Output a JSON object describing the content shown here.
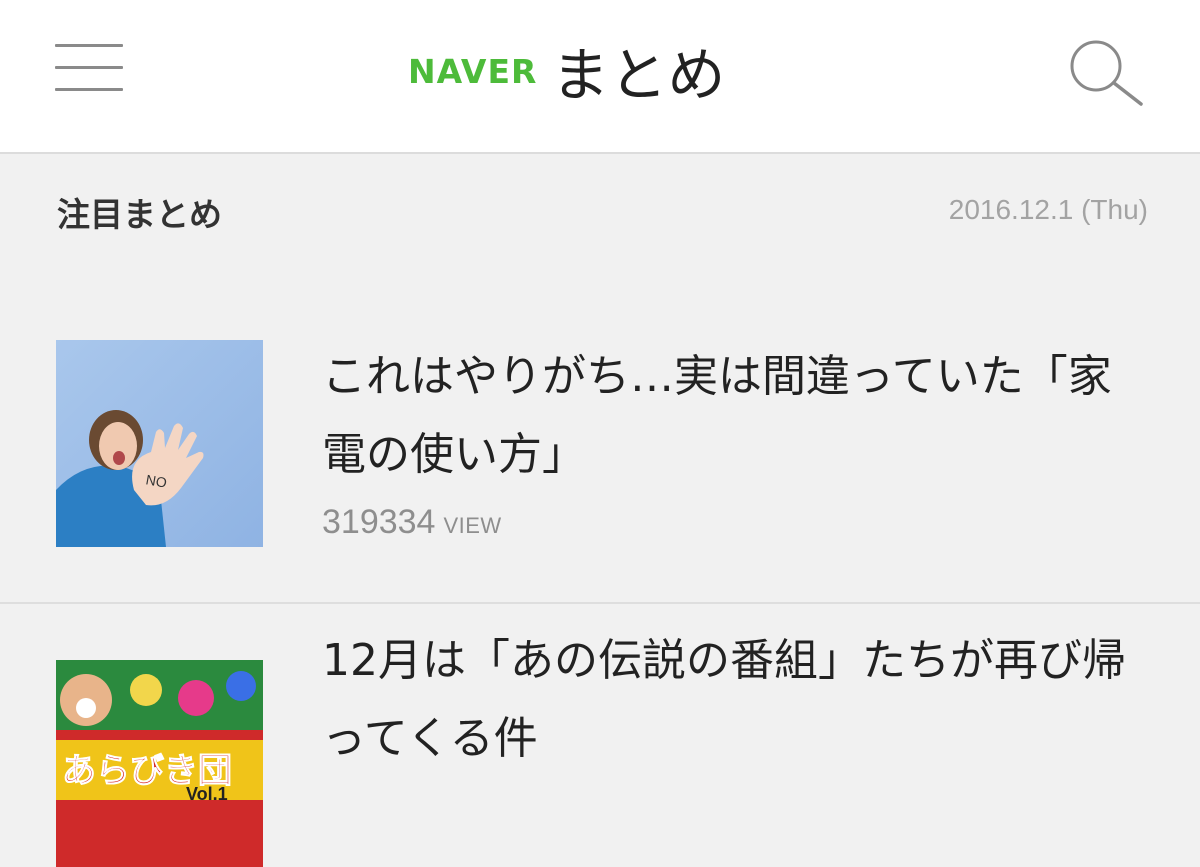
{
  "header": {
    "logo_brand": "NAVER",
    "logo_text": "まとめ",
    "menu_icon": "hamburger-icon",
    "search_icon": "search-icon",
    "accent_color": "#4dbb3a"
  },
  "section": {
    "title": "注目まとめ",
    "date": "2016.12.1 (Thu)"
  },
  "articles": [
    {
      "title": "これはやりがち…実は間違っていた「家電の使い方」",
      "views": "319334",
      "views_unit": "VIEW",
      "thumb_text": "NO"
    },
    {
      "title": "12月は「あの伝説の番組」たちが再び帰ってくる件",
      "thumb_text": "あらびき団",
      "thumb_subtext": "Vol.1"
    }
  ]
}
